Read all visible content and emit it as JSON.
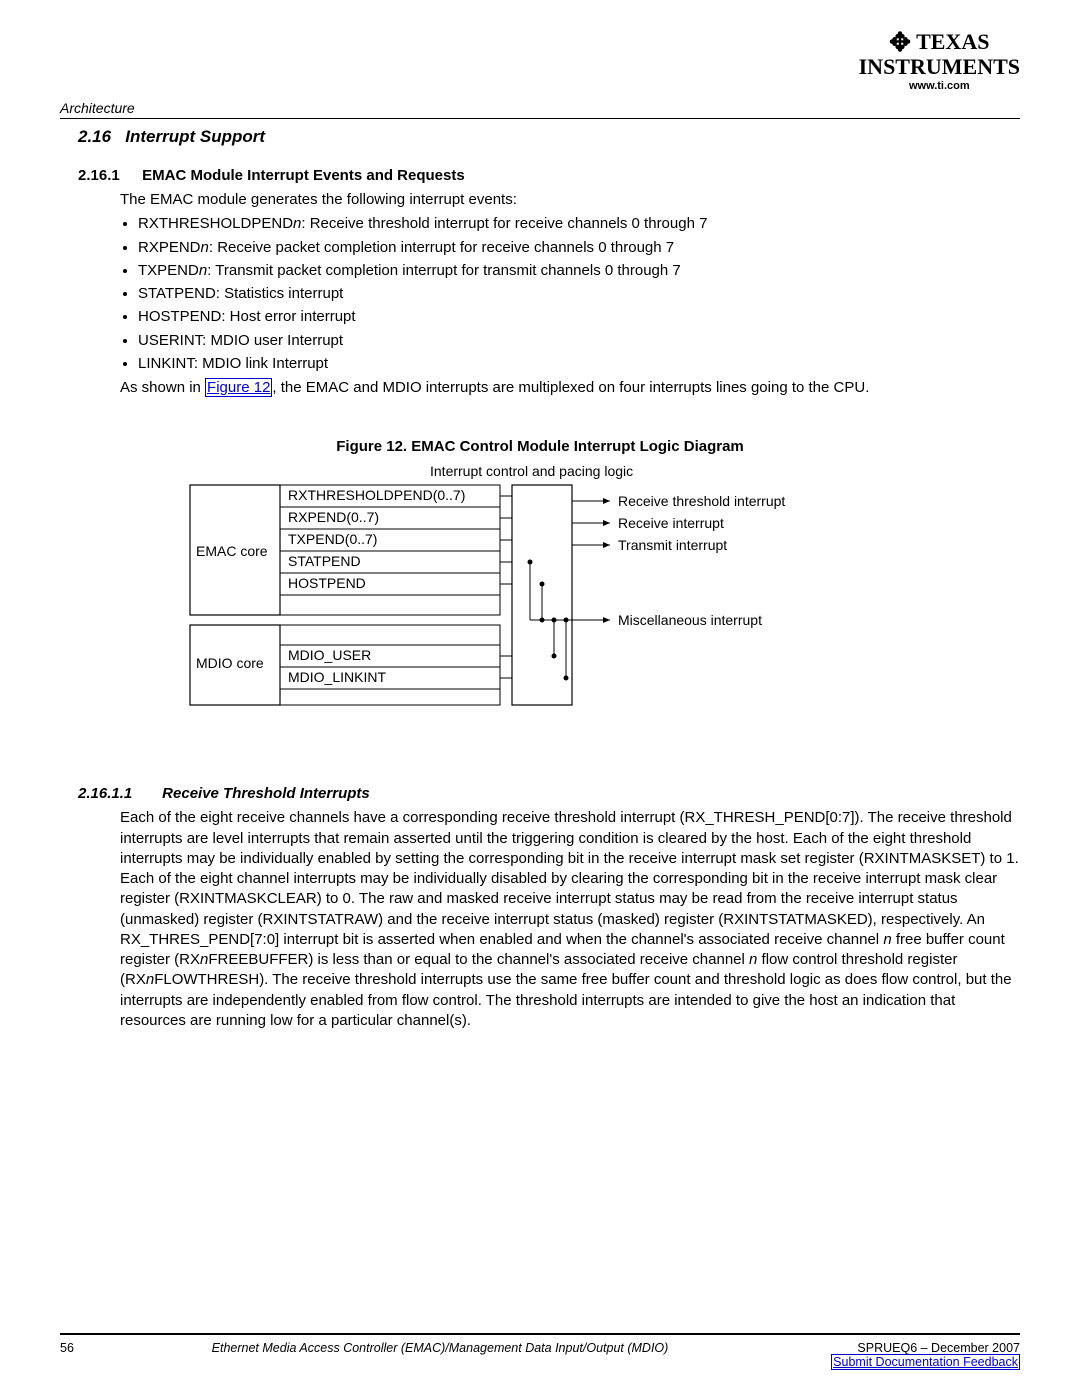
{
  "header": {
    "logo_line1": "TEXAS",
    "logo_line2": "INSTRUMENTS",
    "url": "www.ti.com",
    "section_tag": "Architecture"
  },
  "sections": {
    "h2_num": "2.16",
    "h2_title": "Interrupt Support",
    "h3_num": "2.16.1",
    "h3_title": "EMAC Module Interrupt Events and Requests",
    "intro": "The EMAC module generates the following interrupt events:",
    "bullets": [
      {
        "pre": "RXTHRESHOLDPEND",
        "n": "n",
        "post": ": Receive threshold interrupt for receive channels 0 through 7"
      },
      {
        "pre": "RXPEND",
        "n": "n",
        "post": ": Receive packet completion interrupt for receive channels 0 through 7"
      },
      {
        "pre": "TXPEND",
        "n": "n",
        "post": ": Transmit packet completion interrupt for transmit channels 0 through 7"
      },
      {
        "pre": "STATPEND: Statistics interrupt",
        "n": "",
        "post": ""
      },
      {
        "pre": "HOSTPEND: Host error interrupt",
        "n": "",
        "post": ""
      },
      {
        "pre": "USERINT: MDIO user Interrupt",
        "n": "",
        "post": ""
      },
      {
        "pre": "LINKINT: MDIO link Interrupt",
        "n": "",
        "post": ""
      }
    ],
    "after_pre": "As shown in ",
    "figlink": "Figure 12",
    "after_post": ", the EMAC and MDIO interrupts are multiplexed on four interrupts lines going to the CPU."
  },
  "figure": {
    "caption": "Figure 12. EMAC Control Module Interrupt Logic Diagram",
    "top_label": "Interrupt control and pacing logic",
    "emac_core": "EMAC core",
    "mdio_core": "MDIO core",
    "signals": {
      "rxthresh": "RXTHRESHOLDPEND(0..7)",
      "rxpend": "RXPEND(0..7)",
      "txpend": "TXPEND(0..7)",
      "statpend": "STATPEND",
      "hostpend": "HOSTPEND",
      "mdio_user": "MDIO_USER",
      "mdio_link": "MDIO_LINKINT"
    },
    "outputs": {
      "rxthresh": "Receive threshold interrupt",
      "rx": "Receive interrupt",
      "tx": "Transmit interrupt",
      "misc": "Miscellaneous interrupt"
    }
  },
  "subsec": {
    "h4_num": "2.16.1.1",
    "h4_title": "Receive Threshold Interrupts",
    "para_a": "Each of the eight receive channels have a corresponding receive threshold interrupt (RX_THRESH_PEND[0:7]). The receive threshold interrupts are level interrupts that remain asserted until the triggering condition is cleared by the host. Each of the eight threshold interrupts may be individually enabled by setting the corresponding bit in the receive interrupt mask set register (RXINTMASKSET) to 1. Each of the eight channel interrupts may be individually disabled by clearing the corresponding bit in the receive interrupt mask clear register (RXINTMASKCLEAR) to 0. The raw and masked receive interrupt status may be read from the receive interrupt status (unmasked) register (RXINTSTATRAW) and the receive interrupt status (masked) register (RXINTSTATMASKED), respectively. An RX_THRES_PEND[7:0] interrupt bit is asserted when enabled and when the channel's associated receive channel ",
    "para_b": " free buffer count register (RX",
    "para_c": "FREEBUFFER) is less than or equal to the channel's associated receive channel ",
    "para_d": " flow control threshold register (RX",
    "para_e": "FLOWTHRESH). The receive threshold interrupts use the same free buffer count and threshold logic as does flow control, but the interrupts are independently enabled from flow control. The threshold interrupts are intended to give the host an indication that resources are running low for a particular channel(s).",
    "n": "n"
  },
  "footer": {
    "page": "56",
    "title": "Ethernet Media Access Controller (EMAC)/Management Data Input/Output (MDIO)",
    "doc": "SPRUEQ6 – December 2007",
    "link": "Submit Documentation Feedback"
  }
}
